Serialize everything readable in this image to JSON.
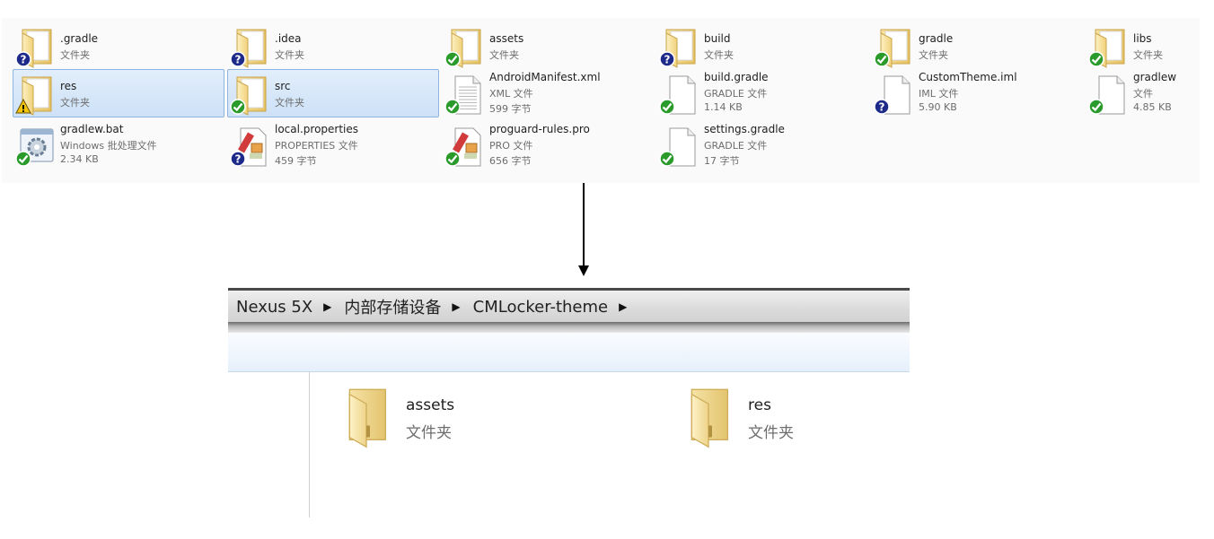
{
  "top_explorer": {
    "items": [
      {
        "name": ".gradle",
        "type": "文件夹",
        "size": "",
        "icon": "folder-icon",
        "status": "unversioned-icon",
        "selected": false
      },
      {
        "name": ".idea",
        "type": "文件夹",
        "size": "",
        "icon": "folder-icon",
        "status": "unversioned-icon",
        "selected": false
      },
      {
        "name": "assets",
        "type": "文件夹",
        "size": "",
        "icon": "folder-icon",
        "status": "normal-icon",
        "selected": false
      },
      {
        "name": "build",
        "type": "文件夹",
        "size": "",
        "icon": "folder-icon",
        "status": "unversioned-icon",
        "selected": false
      },
      {
        "name": "gradle",
        "type": "文件夹",
        "size": "",
        "icon": "folder-icon",
        "status": "normal-icon",
        "selected": false
      },
      {
        "name": "libs",
        "type": "文件夹",
        "size": "",
        "icon": "folder-icon",
        "status": "normal-icon",
        "selected": false
      },
      {
        "name": "res",
        "type": "文件夹",
        "size": "",
        "icon": "folder-icon",
        "status": "warning-icon",
        "selected": true
      },
      {
        "name": "src",
        "type": "文件夹",
        "size": "",
        "icon": "folder-icon",
        "status": "normal-icon",
        "selected": true
      },
      {
        "name": "AndroidManifest.xml",
        "type": "XML 文件",
        "size": "599 字节",
        "icon": "xml-file-icon",
        "status": "normal-icon",
        "selected": false
      },
      {
        "name": "build.gradle",
        "type": "GRADLE 文件",
        "size": "1.14 KB",
        "icon": "file-icon",
        "status": "normal-icon",
        "selected": false
      },
      {
        "name": "CustomTheme.iml",
        "type": "IML 文件",
        "size": "5.90 KB",
        "icon": "file-icon",
        "status": "unversioned-icon",
        "selected": false
      },
      {
        "name": "gradlew",
        "type": "文件",
        "size": "4.85 KB",
        "icon": "file-icon",
        "status": "normal-icon",
        "selected": false
      },
      {
        "name": "gradlew.bat",
        "type": "Windows 批处理文件",
        "size": "2.34 KB",
        "icon": "batch-file-icon",
        "status": "normal-icon",
        "selected": false
      },
      {
        "name": "local.properties",
        "type": "PROPERTIES 文件",
        "size": "459 字节",
        "icon": "properties-file-icon",
        "status": "unversioned-icon",
        "selected": false
      },
      {
        "name": "proguard-rules.pro",
        "type": "PRO 文件",
        "size": "656 字节",
        "icon": "properties-file-icon",
        "status": "normal-icon",
        "selected": false
      },
      {
        "name": "settings.gradle",
        "type": "GRADLE 文件",
        "size": "17 字节",
        "icon": "file-icon",
        "status": "normal-icon",
        "selected": false
      }
    ]
  },
  "arrow_icon": "down-arrow-icon",
  "bottom_explorer": {
    "breadcrumb": [
      "Nexus 5X",
      "内部存储设备",
      "CMLocker-theme"
    ],
    "breadcrumb_separator": "▶",
    "items": [
      {
        "name": "assets",
        "type": "文件夹",
        "icon": "folder-icon"
      },
      {
        "name": "res",
        "type": "文件夹",
        "icon": "folder-icon"
      }
    ]
  },
  "colors": {
    "selection": "#cde1f7",
    "status_ok": "#2a9a2a",
    "status_unknown": "#1e2a8a",
    "status_warning": "#f2c40c"
  }
}
